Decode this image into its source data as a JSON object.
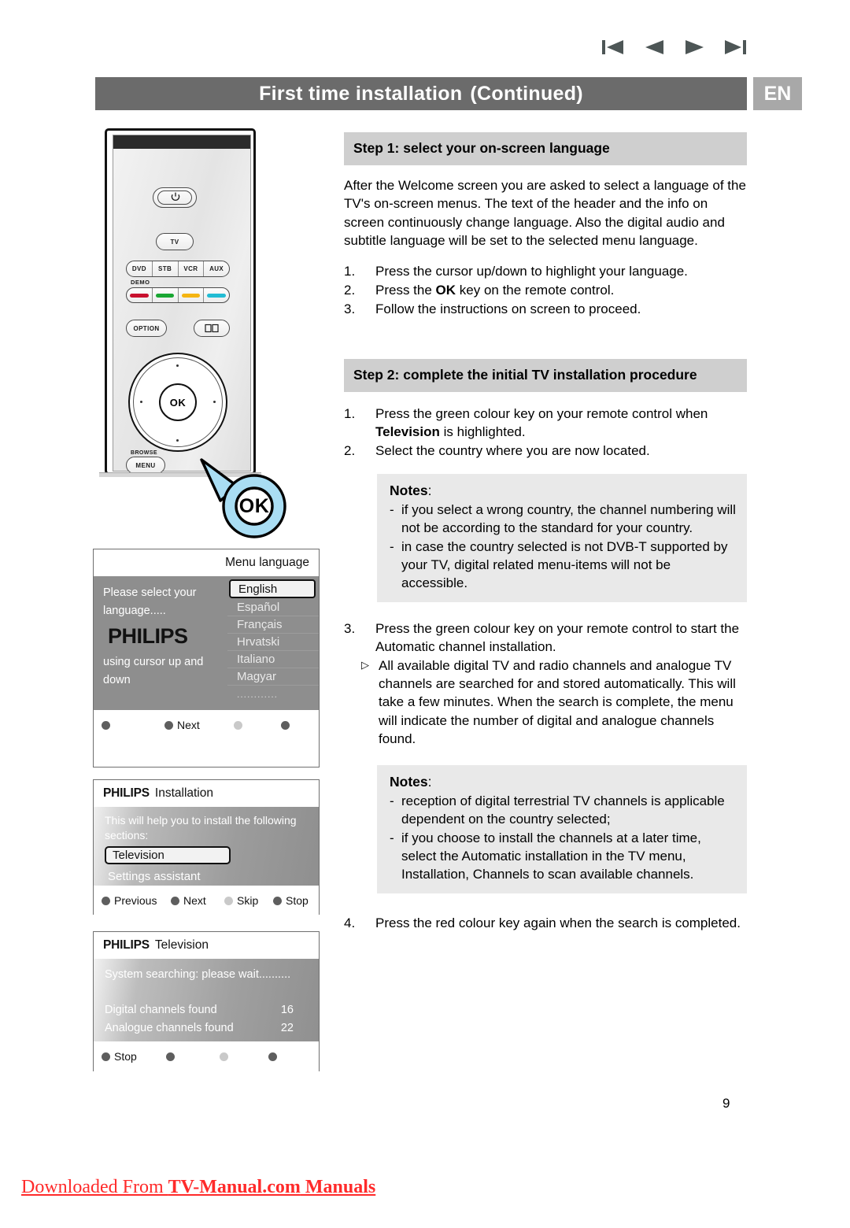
{
  "nav": {
    "first_label": "first-page",
    "prev_label": "previous-page",
    "next_label": "next-page",
    "last_label": "last-page"
  },
  "header": {
    "title": "First time installation",
    "continued": "(Continued)",
    "language_badge": "EN"
  },
  "step1": {
    "heading": "Step 1: select your on-screen language",
    "paragraph": "After the Welcome screen you are asked to select a language of the TV's on-screen menus. The text of the header and the info on screen continuously change language. Also the digital audio and subtitle language will be set to the selected menu language.",
    "items": [
      {
        "num": "1.",
        "text_before": "Press the cursor up/down to highlight your language.",
        "bold": "",
        "text_after": ""
      },
      {
        "num": "2.",
        "text_before": "Press the ",
        "bold": "OK",
        "text_after": " key on the remote control."
      },
      {
        "num": "3.",
        "text_before": "Follow the instructions on screen to proceed.",
        "bold": "",
        "text_after": ""
      }
    ]
  },
  "step2": {
    "heading": "Step 2: complete the initial TV installation procedure",
    "item1_num": "1.",
    "item1_before": "Press the green colour key on your remote control when ",
    "item1_bold": "Television",
    "item1_after": " is highlighted.",
    "item2_num": "2.",
    "item2_text": "Select the country where you are now located.",
    "notes1_title": "Notes",
    "notes1_colon": ":",
    "notes1_items": [
      "if you select a wrong country, the channel numbering will not be according to the standard for your country.",
      "in case the country selected is not DVB-T supported by your TV,  digital related menu-items will not be accessible."
    ],
    "item3_num": "3.",
    "item3_text": "Press the green colour key on your remote control to start the Automatic channel installation.",
    "item3_sub_marker": "▷",
    "item3_sub_text": "All available digital TV and radio channels and analogue TV channels  are searched for and stored automatically. This will take a few minutes. When the search is complete, the menu will indicate the number of digital and analogue channels found.",
    "notes2_title": "Notes",
    "notes2_colon": ":",
    "notes2_items": [
      "reception of digital terrestrial TV channels is applicable dependent on the country selected;",
      "if you choose to install the channels at a later time, select the Automatic installation in the TV menu, Installation, Channels to scan available channels."
    ],
    "item4_num": "4.",
    "item4_text": "Press the red colour key again when the search is completed."
  },
  "remote": {
    "power_label": "power",
    "tv_label": "TV",
    "source_buttons": [
      "DVD",
      "STB",
      "VCR",
      "AUX"
    ],
    "demo_label": "DEMO",
    "colour_keys": [
      "#c8102e",
      "#1aa733",
      "#f5b512",
      "#22bcd4"
    ],
    "option_label": "OPTION",
    "book_label": "book-icon",
    "ok_label": "OK",
    "browse_label": "BROWSE",
    "menu_label": "MENU"
  },
  "callout": {
    "ok_label": "OK",
    "fill": "#a9ddf3"
  },
  "screen_language": {
    "title": "Menu language",
    "left_text_top": "Please select your\nlanguage.....",
    "logo": "PHILIPS",
    "left_text_bottom": "using cursor up and\ndown",
    "options": [
      "English",
      "Español",
      "Français",
      "Hrvatski",
      "Italiano",
      "Magyar",
      "............"
    ],
    "selected": "English",
    "footer": [
      {
        "label": "",
        "color": "#5e5e5e"
      },
      {
        "label": "Next",
        "color": "#5e5e5e"
      },
      {
        "label": "",
        "color": "#c9c9c9"
      },
      {
        "label": "",
        "color": "#5e5e5e"
      }
    ]
  },
  "screen_installation": {
    "brand": "PHILIPS",
    "title": "Installation",
    "lead": "This will help you to install the following sections:",
    "items": [
      "Television",
      "Settings assistant"
    ],
    "selected": "Television",
    "footer": [
      {
        "label": "Previous",
        "color": "#5e5e5e"
      },
      {
        "label": "Next",
        "color": "#5e5e5e"
      },
      {
        "label": "Skip",
        "color": "#c9c9c9"
      },
      {
        "label": "Stop",
        "color": "#5e5e5e"
      }
    ]
  },
  "screen_television": {
    "brand": "PHILIPS",
    "title": "Television",
    "status": "System searching: please wait..........",
    "rows": [
      {
        "label": "Digital channels found",
        "value": "16"
      },
      {
        "label": "Analogue channels found",
        "value": "22"
      }
    ],
    "footer": [
      {
        "label": "Stop",
        "color": "#5e5e5e"
      },
      {
        "label": "",
        "color": "#5e5e5e"
      },
      {
        "label": "",
        "color": "#c9c9c9"
      },
      {
        "label": "",
        "color": "#5e5e5e"
      }
    ]
  },
  "page_number": "9",
  "watermark": {
    "part1": "Downloaded From ",
    "part2": "TV-Manual.com",
    "part3": " Manuals"
  }
}
